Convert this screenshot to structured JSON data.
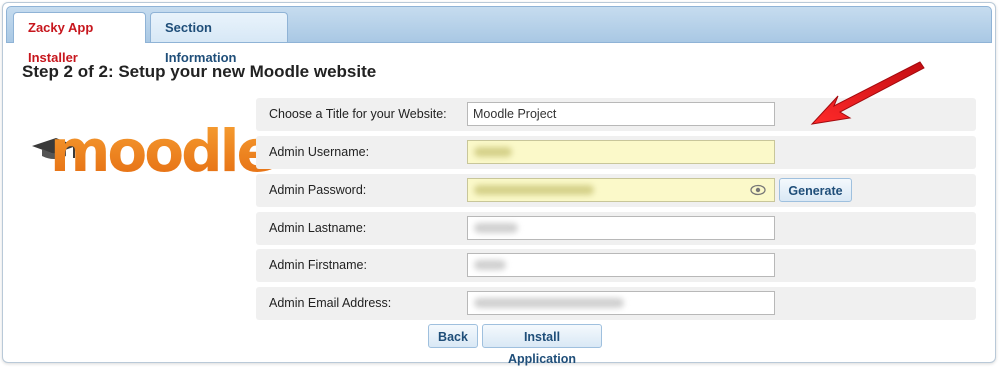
{
  "tabs": [
    {
      "label": "Zacky App Installer",
      "active": true
    },
    {
      "label": "Section Information",
      "active": false
    }
  ],
  "heading": "Step 2 of 2: Setup your new Moodle website",
  "logo": {
    "text": "moodle",
    "icon": "graduation-cap-icon"
  },
  "form": {
    "title": {
      "label": "Choose a Title for your Website:",
      "value": "Moodle Project"
    },
    "username": {
      "label": "Admin Username:",
      "value": ""
    },
    "password": {
      "label": "Admin Password:",
      "value": ""
    },
    "lastname": {
      "label": "Admin Lastname:",
      "value": ""
    },
    "firstname": {
      "label": "Admin Firstname:",
      "value": ""
    },
    "email": {
      "label": "Admin Email Address:",
      "value": ""
    }
  },
  "buttons": {
    "generate": "Generate",
    "back": "Back",
    "install": "Install Application"
  },
  "colors": {
    "active_tab_text": "#c7161d",
    "tab_text": "#1f4e79",
    "logo_orange": "#f28a1e",
    "autofill_yellow": "#fbf9c9",
    "annotation_arrow": "#e8141a"
  }
}
